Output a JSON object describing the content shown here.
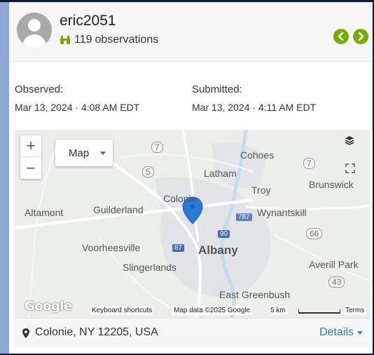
{
  "user": {
    "name": "eric2051",
    "observation_count": "119",
    "observation_label": "observations"
  },
  "dates": {
    "observed_label": "Observed:",
    "observed_value": "Mar 13, 2024 · 4:08 AM EDT",
    "submitted_label": "Submitted:",
    "submitted_value": "Mar 13, 2024 · 4:11 AM EDT"
  },
  "map": {
    "type_label": "Map",
    "places": {
      "cohoes": "Cohoes",
      "latham": "Latham",
      "troy": "Troy",
      "brunswick": "Brunswick",
      "colonie": "Colonie",
      "guilderland": "Guilderland",
      "altamont": "Altamont",
      "wynantskill": "Wynantskill",
      "voorheesville": "Voorheesville",
      "albany": "Albany",
      "slingerlands": "Slingerlands",
      "averill_park": "Averill Park",
      "east_greenbush": "East Greenbush"
    },
    "shields": [
      "7",
      "5",
      "7",
      "787",
      "90",
      "87",
      "66",
      "43"
    ],
    "attribution": {
      "keyboard": "Keyboard shortcuts",
      "mapdata": "Map data ©2025 Google",
      "scale": "5 km",
      "terms": "Terms"
    },
    "logo": "Google"
  },
  "location": {
    "text": "Colonie, NY 12205, USA",
    "details_label": "Details"
  },
  "colors": {
    "accent_green": "#74ac00",
    "link_blue": "#2a7ac0",
    "pin_blue": "#2a79d8"
  },
  "icons": {
    "avatar": "user-avatar-icon",
    "observations": "binoculars-icon",
    "prev": "chevron-left-icon",
    "next": "chevron-right-icon",
    "layers": "layers-icon",
    "fullscreen": "fullscreen-icon",
    "pin": "map-marker-icon",
    "location": "location-pin-icon"
  }
}
